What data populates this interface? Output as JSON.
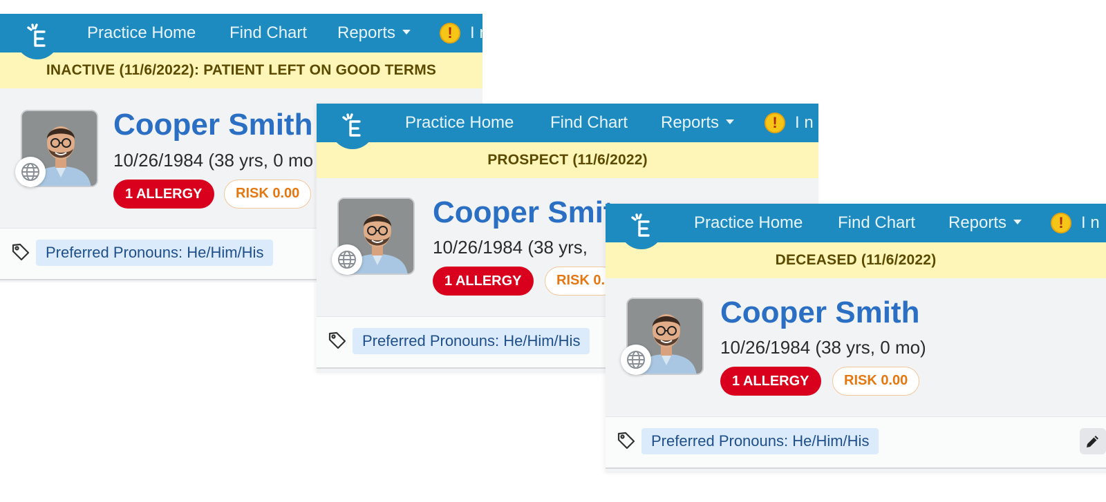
{
  "nav": {
    "items": [
      "Practice Home",
      "Find Chart",
      "Reports"
    ],
    "alert_symbol": "!",
    "truncated_text": "I n",
    "logo_icon": "elation-logo-icon",
    "reports_icon": "caret-down-icon"
  },
  "patient": {
    "name": "Cooper Smith",
    "dob": "10/26/1984 (38 yrs, 0 mo)",
    "allergy_label": "1 ALLERGY",
    "risk_label": "RISK 0.00",
    "pronouns_label": "Preferred Pronouns: He/Him/His",
    "photo_icon": "patient-photo",
    "language_icon": "globe-icon",
    "tag_icon": "tag-icon"
  },
  "panels": [
    {
      "status_banner": "INACTIVE (11/6/2022): PATIENT LEFT ON GOOD TERMS",
      "dob_visible": "10/26/1984 (38 yrs, 0 mo",
      "risk_visible": "RISK 0.00",
      "pronoun_visible": "Preferred Pronouns: He/Him/His",
      "name_visible": "Cooper Smith"
    },
    {
      "status_banner": "PROSPECT (11/6/2022)",
      "dob_visible": "10/26/1984 (38 yrs, ",
      "risk_visible": "RISK 0.",
      "pronoun_visible": "Preferred Pronouns: He/Him/His",
      "name_visible": "Cooper Smit"
    },
    {
      "status_banner": "DECEASED (11/6/2022)",
      "dob_visible": "10/26/1984 (38 yrs, 0 mo)",
      "risk_visible": "RISK 0.00",
      "pronoun_visible": "Preferred Pronouns: He/Him/His",
      "name_visible": "Cooper Smith",
      "edit_icon": "pencil-icon"
    }
  ],
  "colors": {
    "nav_bg": "#1d8ac0",
    "banner_bg": "#fdf6b8",
    "name_blue": "#2a6fc3",
    "allergy_red": "#d8001c",
    "risk_orange": "#e57710",
    "pronoun_bg": "#dcebfb"
  }
}
